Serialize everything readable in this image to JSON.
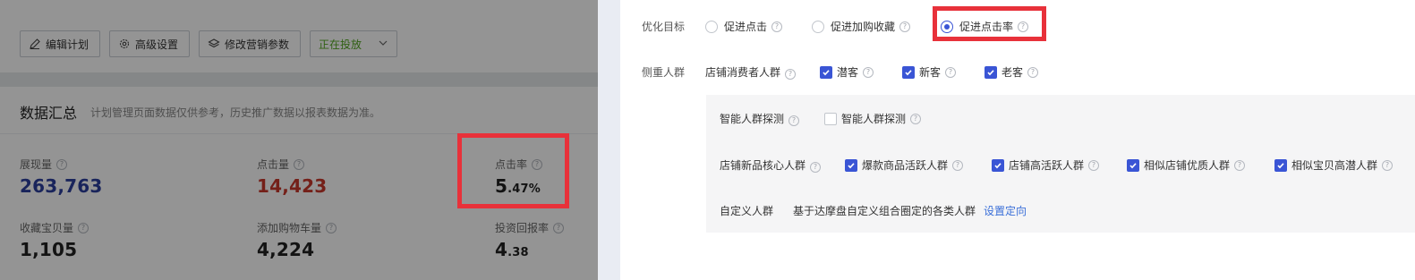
{
  "toolbar": {
    "edit_label": "编辑计划",
    "advanced_label": "高级设置",
    "params_label": "修改营销参数",
    "status_label": "正在投放"
  },
  "summary": {
    "title": "数据汇总",
    "subtitle": "计划管理页面数据仅供参考，历史推广数据以报表数据为准。",
    "metrics": [
      {
        "label": "展现量",
        "value": "263,763"
      },
      {
        "label": "点击量",
        "value": "14,423"
      },
      {
        "label": "点击率",
        "value_int": "5",
        "value_dec": ".47%"
      },
      {
        "label": "收藏宝贝量",
        "value": "1,105"
      },
      {
        "label": "添加购物车量",
        "value": "4,224"
      },
      {
        "label": "投资回报率",
        "value_int": "4",
        "value_dec": ".38"
      }
    ]
  },
  "drawer": {
    "goal_label": "优化目标",
    "goal_options": [
      "促进点击",
      "促进加购收藏",
      "促进点击率"
    ],
    "goal_selected": "促进点击率",
    "focus_label": "侧重人群",
    "store_consumers_label": "店铺消费者人群",
    "consumer_options": [
      "潜客",
      "新客",
      "老客"
    ],
    "smart_label": "智能人群探测",
    "smart_option": "智能人群探测",
    "core_label": "店铺新品核心人群",
    "core_options": [
      "爆款商品活跃人群",
      "店铺高活跃人群",
      "相似店铺优质人群",
      "相似宝贝高潜人群"
    ],
    "custom_label": "自定义人群",
    "custom_desc": "基于达摩盘自定义组合圈定的各类人群",
    "custom_link": "设置定向"
  },
  "colors": {
    "highlight": "#e8313a",
    "accent": "#3a55d5",
    "impressions": "#2b3f9e",
    "clicks": "#c9372c",
    "status": "#52a520"
  }
}
